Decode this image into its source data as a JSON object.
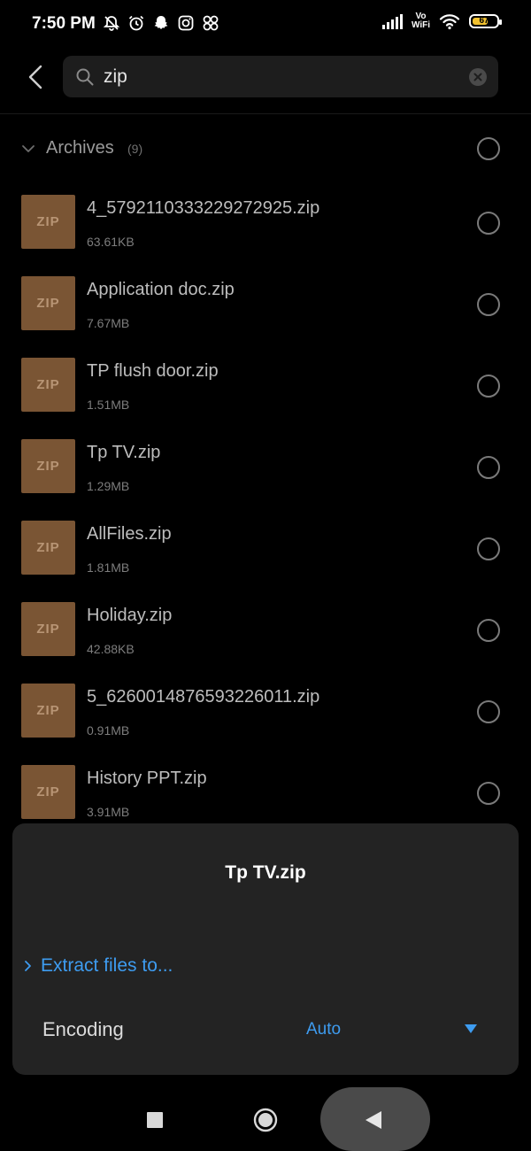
{
  "status_bar": {
    "time": "7:50 PM",
    "vo": "Vo",
    "wifi_label": "WiFi",
    "battery": "67",
    "battery_fraction": 0.67,
    "icons_left": [
      "mute-bell-icon",
      "alarm-icon",
      "snapchat-icon",
      "instagram-icon",
      "pinwheel-icon"
    ]
  },
  "search": {
    "query": "zip"
  },
  "section": {
    "title": "Archives",
    "count": "(9)"
  },
  "files": [
    {
      "name": "4_5792110333229272925.zip",
      "size": "63.61KB",
      "thumb": "ZIP"
    },
    {
      "name": "Application doc.zip",
      "size": "7.67MB",
      "thumb": "ZIP"
    },
    {
      "name": "TP flush door.zip",
      "size": "1.51MB",
      "thumb": "ZIP"
    },
    {
      "name": "Tp TV.zip",
      "size": "1.29MB",
      "thumb": "ZIP"
    },
    {
      "name": "AllFiles.zip",
      "size": "1.81MB",
      "thumb": "ZIP"
    },
    {
      "name": "Holiday.zip",
      "size": "42.88KB",
      "thumb": "ZIP"
    },
    {
      "name": "5_6260014876593226011.zip",
      "size": "0.91MB",
      "thumb": "ZIP"
    },
    {
      "name": "History PPT.zip",
      "size": "3.91MB",
      "thumb": "ZIP"
    }
  ],
  "sheet": {
    "title": "Tp TV.zip",
    "extract_label": "Extract files to...",
    "encoding_label": "Encoding",
    "encoding_value": "Auto"
  },
  "colors": {
    "accent": "#3e9cf0",
    "zip_thumb": "#7a5534",
    "sheet_bg": "#232323"
  }
}
